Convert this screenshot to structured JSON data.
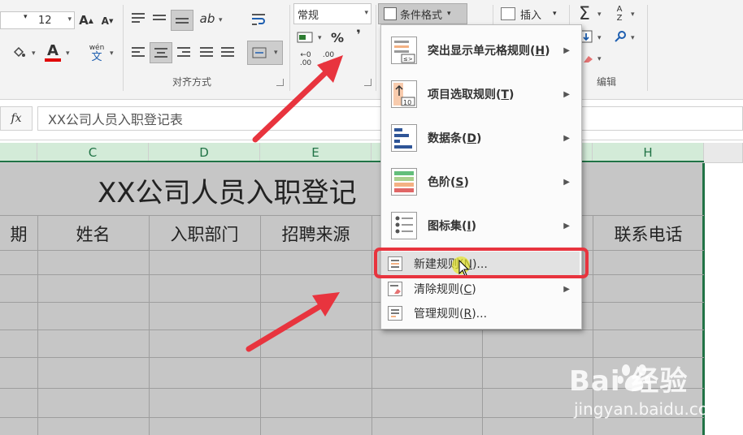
{
  "ribbon": {
    "font_size": "12",
    "number_format": "常规",
    "group_alignment": "对齐方式",
    "group_editing": "编辑",
    "conditional_format": "条件格式",
    "insert": "插入",
    "wen": "wén",
    "wen_char": "文",
    "percent": "%",
    "comma": "❜",
    "inc_decimal_top": "←0",
    "inc_decimal_bottom": ".00",
    "dec_decimal_top": ".00",
    "dec_decimal_bottom": "→0",
    "font_grow": "A",
    "font_shrink": "A",
    "font_color": "A",
    "sum": "Σ",
    "sort_a": "A",
    "sort_z": "Z"
  },
  "formula_bar": {
    "fx": "fx",
    "content": "XX公司人员入职登记表"
  },
  "columns": [
    "C",
    "D",
    "E",
    "H"
  ],
  "sheet": {
    "title": "XX公司人员入职登记",
    "headers": {
      "b": "期",
      "c": "姓名",
      "d": "入职部门",
      "e": "招聘来源",
      "h": "联系电话"
    }
  },
  "menu": {
    "items": [
      {
        "label": "突出显示单元格规则",
        "key": "H"
      },
      {
        "label": "项目选取规则",
        "key": "T"
      },
      {
        "label": "数据条",
        "key": "D"
      },
      {
        "label": "色阶",
        "key": "S"
      },
      {
        "label": "图标集",
        "key": "I"
      }
    ],
    "small_items": [
      {
        "label": "新建规则",
        "key": "N",
        "suffix": "..."
      },
      {
        "label": "清除规则",
        "key": "C",
        "suffix": ""
      },
      {
        "label": "管理规则",
        "key": "R",
        "suffix": "..."
      }
    ]
  },
  "watermark": {
    "main": "Bai  经验",
    "sub": "jingyan.baidu.com"
  },
  "colors": {
    "excel_green": "#217346",
    "annotation_red": "#e8343e",
    "sheet_selection": "#c6c6c6"
  },
  "icons": [
    "paint-bucket-icon",
    "font-color-icon",
    "wrap-text-icon",
    "merge-icon",
    "currency-icon",
    "conditional-format-icon",
    "insert-cells-icon",
    "sum-icon",
    "sort-icon",
    "fill-icon",
    "clear-icon",
    "find-icon",
    "cursor-icon",
    "red-arrow"
  ]
}
